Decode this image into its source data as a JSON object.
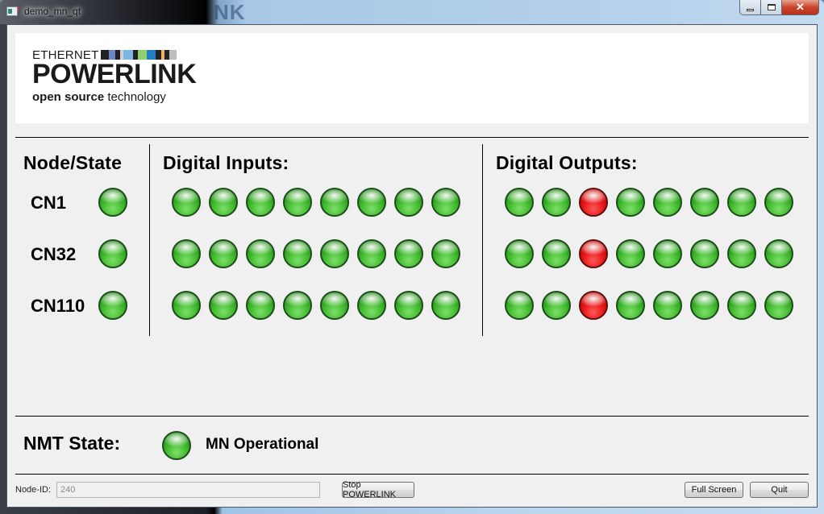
{
  "window": {
    "title": "demo_mn_qt",
    "background_ghost_text": "NK",
    "controls": {
      "minimize": "minimize",
      "maximize": "maximize",
      "close": "✕"
    }
  },
  "logo": {
    "ethernet": "ETHERNET",
    "powerlink": "POWERLINK",
    "tagline_bold": "open source",
    "tagline_rest": " technology",
    "bar_colors": [
      "#222222",
      "#6b86c6",
      "#222222",
      "#d0d0d0",
      "#7bb6e3",
      "#222222",
      "#8fcf6f",
      "#1f7fc0",
      "#222222",
      "#f0b060",
      "#222222",
      "#bdbdbd"
    ]
  },
  "headers": {
    "node_state": "Node/State",
    "digital_inputs": "Digital Inputs:",
    "digital_outputs": "Digital Outputs:"
  },
  "nodes": [
    {
      "name": "CN1",
      "state": "green",
      "inputs": [
        "green",
        "green",
        "green",
        "green",
        "green",
        "green",
        "green",
        "green"
      ],
      "outputs": [
        "green",
        "green",
        "red",
        "green",
        "green",
        "green",
        "green",
        "green"
      ]
    },
    {
      "name": "CN32",
      "state": "green",
      "inputs": [
        "green",
        "green",
        "green",
        "green",
        "green",
        "green",
        "green",
        "green"
      ],
      "outputs": [
        "green",
        "green",
        "red",
        "green",
        "green",
        "green",
        "green",
        "green"
      ]
    },
    {
      "name": "CN110",
      "state": "green",
      "inputs": [
        "green",
        "green",
        "green",
        "green",
        "green",
        "green",
        "green",
        "green"
      ],
      "outputs": [
        "green",
        "green",
        "red",
        "green",
        "green",
        "green",
        "green",
        "green"
      ]
    }
  ],
  "nmt": {
    "label": "NMT State:",
    "led": "green",
    "status": "MN Operational"
  },
  "footer": {
    "node_id_label": "Node-ID:",
    "node_id_value": "240",
    "stop_button": "Stop POWERLINK",
    "fullscreen_button": "Full Screen",
    "quit_button": "Quit"
  },
  "colors": {
    "led_on": "#3fb82c",
    "led_off": "#e61414"
  }
}
